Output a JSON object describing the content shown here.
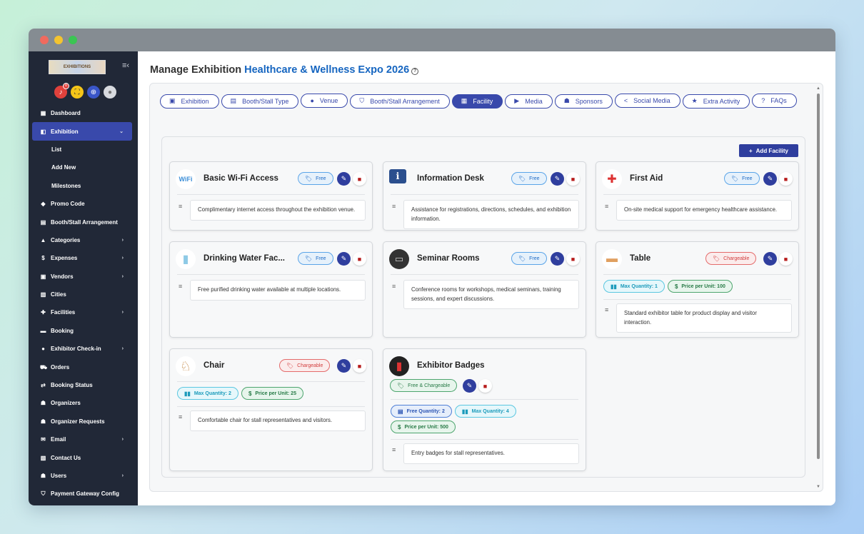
{
  "sidebar": {
    "logo_text": "EXHIBITIONS",
    "notification_count": "0",
    "items": [
      {
        "label": "Dashboard",
        "icon": "dashboard-icon",
        "glyph": "▦",
        "caret": ""
      },
      {
        "label": "Exhibition",
        "icon": "exhibition-icon",
        "glyph": "◧",
        "caret": "⌄",
        "active": true
      },
      {
        "label": "List",
        "sub": true
      },
      {
        "label": "Add New",
        "sub": true
      },
      {
        "label": "Milestones",
        "sub": true
      },
      {
        "label": "Promo Code",
        "icon": "tag-icon",
        "glyph": "◆",
        "caret": ""
      },
      {
        "label": "Booth/Stall Arrangement",
        "icon": "booth-icon",
        "glyph": "▤",
        "caret": ""
      },
      {
        "label": "Categories",
        "icon": "categories-icon",
        "glyph": "▲",
        "caret": "›"
      },
      {
        "label": "Expenses",
        "icon": "dollar-icon",
        "glyph": "$",
        "caret": "›"
      },
      {
        "label": "Vendors",
        "icon": "vendor-icon",
        "glyph": "▣",
        "caret": "›"
      },
      {
        "label": "Cities",
        "icon": "city-icon",
        "glyph": "▥",
        "caret": ""
      },
      {
        "label": "Facilities",
        "icon": "facilities-icon",
        "glyph": "✚",
        "caret": "›"
      },
      {
        "label": "Booking",
        "icon": "booking-icon",
        "glyph": "▬",
        "caret": ""
      },
      {
        "label": "Exhibitor Check-in",
        "icon": "checkin-icon",
        "glyph": "●",
        "caret": "›"
      },
      {
        "label": "Orders",
        "icon": "cart-icon",
        "glyph": "⛟",
        "caret": ""
      },
      {
        "label": "Booking Status",
        "icon": "status-icon",
        "glyph": "⇄",
        "caret": ""
      },
      {
        "label": "Organizers",
        "icon": "organizers-icon",
        "glyph": "☗",
        "caret": ""
      },
      {
        "label": "Organizer Requests",
        "icon": "requests-icon",
        "glyph": "☗",
        "caret": ""
      },
      {
        "label": "Email",
        "icon": "email-icon",
        "glyph": "✉",
        "caret": "›"
      },
      {
        "label": "Contact Us",
        "icon": "contact-icon",
        "glyph": "▧",
        "caret": ""
      },
      {
        "label": "Users",
        "icon": "users-icon",
        "glyph": "☗",
        "caret": "›"
      },
      {
        "label": "Payment Gateway Config",
        "icon": "shield-icon",
        "glyph": "⛉",
        "caret": ""
      }
    ]
  },
  "header": {
    "prefix": "Manage Exhibition",
    "exhibition_name": "Healthcare & Wellness Expo 2026",
    "help_glyph": "?"
  },
  "tabs": [
    {
      "label": "Exhibition",
      "icon": "calendar-icon",
      "glyph": "▣"
    },
    {
      "label": "Booth/Stall Type",
      "icon": "booth-type-icon",
      "glyph": "▤"
    },
    {
      "label": "Venue",
      "icon": "location-icon",
      "glyph": "●"
    },
    {
      "label": "Booth/Stall Arrangement",
      "icon": "arrangement-icon",
      "glyph": "⛉"
    },
    {
      "label": "Facility",
      "icon": "building-icon",
      "glyph": "▦",
      "active": true
    },
    {
      "label": "Media",
      "icon": "media-icon",
      "glyph": "▶"
    },
    {
      "label": "Sponsors",
      "icon": "sponsors-icon",
      "glyph": "☗"
    },
    {
      "label": "Social Media",
      "icon": "share-icon",
      "glyph": "<"
    },
    {
      "label": "Extra Activity",
      "icon": "star-icon",
      "glyph": "★"
    },
    {
      "label": "FAQs",
      "icon": "question-icon",
      "glyph": "?"
    }
  ],
  "add_button": {
    "label": "Add Facility",
    "glyph": "+"
  },
  "facilities": [
    {
      "name": "Basic Wi-Fi Access",
      "type": "Free",
      "icon": "wifi-icon",
      "glyph": "WiFi",
      "description": "Complimentary internet access throughout the exhibition venue."
    },
    {
      "name": "Information Desk",
      "type": "Free",
      "icon": "info-desk-icon",
      "glyph": "ℹ",
      "description": "Assistance for registrations, directions, schedules, and exhibition information."
    },
    {
      "name": "First Aid",
      "type": "Free",
      "icon": "first-aid-icon",
      "glyph": "✚",
      "description": "On-site medical support for emergency healthcare assistance."
    },
    {
      "name": "Drinking Water Fac...",
      "type": "Free",
      "icon": "water-bottle-icon",
      "glyph": "▮",
      "description": "Free purified drinking water available at multiple locations."
    },
    {
      "name": "Seminar Rooms",
      "type": "Free",
      "icon": "seminar-room-icon",
      "glyph": "▭",
      "description": "Conference rooms for workshops, medical seminars, training sessions, and expert discussions."
    },
    {
      "name": "Table",
      "type": "Chargeable",
      "icon": "table-icon",
      "glyph": "▬",
      "max_quantity": "Max Quantity: 1",
      "price": "Price per Unit: 100",
      "description": "Standard exhibitor table for product display and visitor interaction."
    },
    {
      "name": "Chair",
      "type": "Chargeable",
      "icon": "chair-icon",
      "glyph": "♘",
      "max_quantity": "Max Quantity: 2",
      "price": "Price per Unit: 25",
      "description": "Comfortable chair for stall representatives and visitors."
    },
    {
      "name": "Exhibitor Badges",
      "type": "Free & Chargeable",
      "icon": "badge-icon",
      "glyph": "▮",
      "free_quantity": "Free Quantity: 2",
      "max_quantity": "Max Quantity: 4",
      "price": "Price per Unit: 500",
      "description": "Entry badges for stall representatives."
    }
  ],
  "colors": {
    "sidebar_bg": "#212837",
    "accent": "#3949ab",
    "brand_blue": "#1565c0",
    "free": "#1e6bc6",
    "chargeable": "#d23c3c",
    "price": "#277a46"
  }
}
